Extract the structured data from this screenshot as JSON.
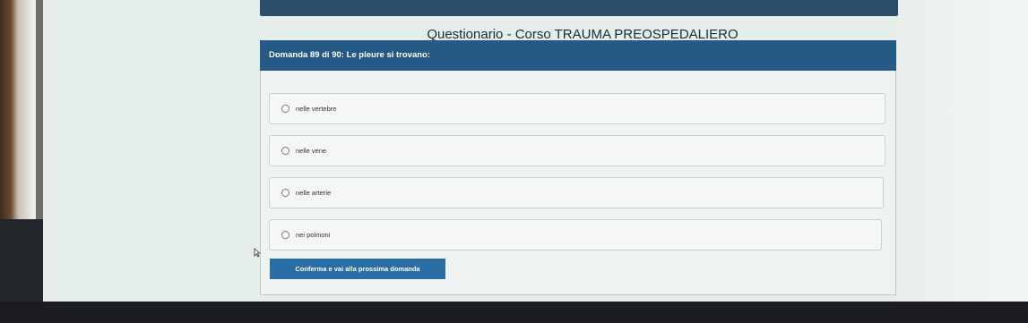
{
  "page": {
    "title": "Questionario - Corso TRAUMA PREOSPEDALIERO"
  },
  "question": {
    "text": "Domanda 89 di 90: Le pleure si trovano:",
    "options": [
      {
        "label": "nelle vertebre"
      },
      {
        "label": "nelle vene"
      },
      {
        "label": "nelle arterie"
      },
      {
        "label": "nei polmoni"
      }
    ]
  },
  "actions": {
    "confirm_label": "Conferma e vai alla prossima domanda"
  },
  "colors": {
    "header_bar": "#245a85",
    "button": "#2a6ea6"
  }
}
